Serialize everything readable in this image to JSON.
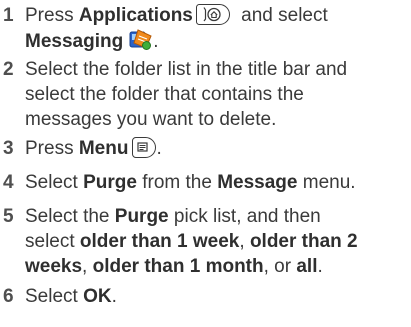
{
  "steps": [
    {
      "number": "1",
      "t1": "Press ",
      "b1": "Applications",
      "t2": " and select",
      "b2": "Messaging",
      "t3": ".",
      "icon_apps": "home-button-icon",
      "icon_app": "messaging-app-icon"
    },
    {
      "number": "2",
      "line1": "Select the folder list in the title bar and",
      "line2": "select the folder that contains the",
      "line3": "messages you want to delete."
    },
    {
      "number": "3",
      "t1": "Press ",
      "b1": "Menu",
      "t2": ".",
      "icon_menu": "menu-button-icon"
    },
    {
      "number": "4",
      "t1": "Select ",
      "b1": "Purge",
      "t2": " from the ",
      "b2": "Message",
      "t3": " menu."
    },
    {
      "number": "5",
      "t1": "Select the ",
      "b1": "Purge",
      "t2": " pick list, and then",
      "t3": "select ",
      "b2": "older than 1 week",
      "t4": ", ",
      "b3": "older than 2",
      "b4": "weeks",
      "t5": ", ",
      "b5": "older than 1 month",
      "t6": ", or ",
      "b6": "all",
      "t7": "."
    },
    {
      "number": "6",
      "t1": "Select ",
      "b1": "OK",
      "t2": "."
    }
  ],
  "colors": {
    "text": "#3a3a3a",
    "bold_text": "#2f2f2f",
    "number": "#4f4f4f"
  }
}
